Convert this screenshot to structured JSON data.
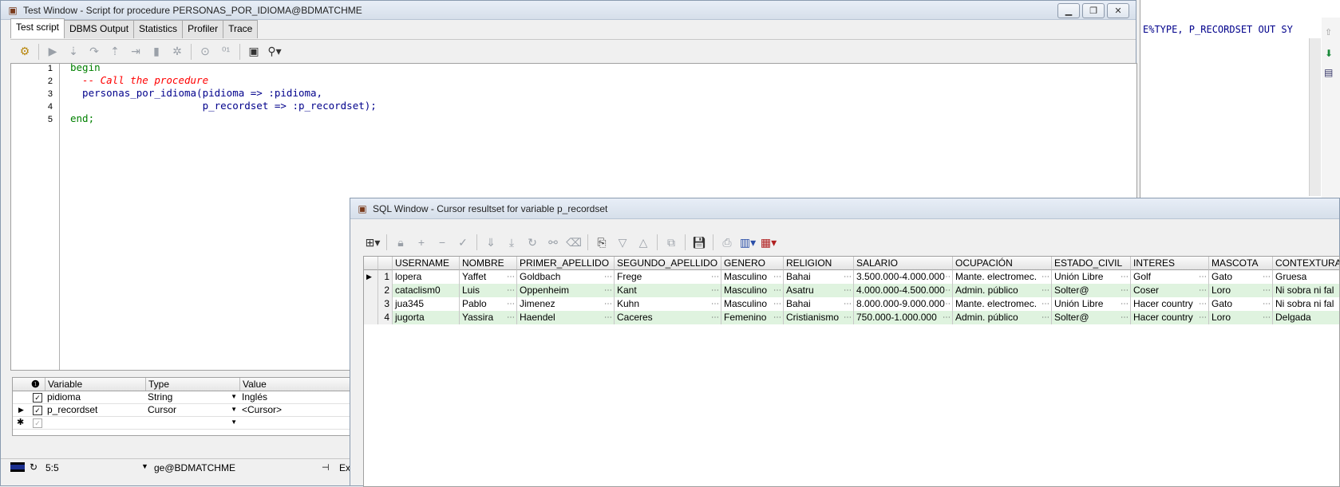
{
  "background_window": {
    "code_fragment": "E%TYPE, P_RECORDSET OUT SY"
  },
  "test_window": {
    "title": "Test Window - Script for procedure PERSONAS_POR_IDIOMA@BDMATCHME",
    "tabs": [
      "Test script",
      "DBMS Output",
      "Statistics",
      "Profiler",
      "Trace"
    ],
    "active_tab": "Test script",
    "code_lines": [
      {
        "n": "1",
        "text": "begin",
        "style": "kw"
      },
      {
        "n": "2",
        "text": "  -- Call the procedure",
        "style": "cm"
      },
      {
        "n": "3",
        "text": "  personas_por_idioma(pidioma => :pidioma,",
        "style": "id"
      },
      {
        "n": "4",
        "text": "                      p_recordset => :p_recordset);",
        "style": "id"
      },
      {
        "n": "5",
        "text": "end;",
        "style": "kw"
      }
    ],
    "variables": {
      "headers": [
        "Variable",
        "Type",
        "Value"
      ],
      "rows": [
        {
          "checked": true,
          "current": false,
          "name": "pidioma",
          "type": "String",
          "value": "Inglés"
        },
        {
          "checked": true,
          "current": true,
          "name": "p_recordset",
          "type": "Cursor",
          "value": "<Cursor>"
        }
      ]
    },
    "status": {
      "position": "5:5",
      "connection": "ge@BDMATCHME",
      "extra": "Ex"
    }
  },
  "sql_window": {
    "title": "SQL Window - Cursor resultset for variable p_recordset",
    "columns": [
      "USERNAME",
      "NOMBRE",
      "PRIMER_APELLIDO",
      "SEGUNDO_APELLIDO",
      "GENERO",
      "RELIGION",
      "SALARIO",
      "OCUPACIÓN",
      "ESTADO_CIVIL",
      "INTERES",
      "MASCOTA",
      "CONTEXTURA"
    ],
    "rows": [
      {
        "n": "1",
        "cells": [
          "lopera",
          "Yaffet",
          "Goldbach",
          "Frege",
          "Masculino",
          "Bahai",
          "3.500.000-4.000.000",
          "Mante. electromec.",
          "Unión Libre",
          "Golf",
          "Gato",
          "Gruesa"
        ]
      },
      {
        "n": "2",
        "cells": [
          "cataclism0",
          "Luis",
          "Oppenheim",
          "Kant",
          "Masculino",
          "Asatru",
          "4.000.000-4.500.000",
          "Admin. público",
          "Solter@",
          "Coser",
          "Loro",
          "Ni sobra ni fal"
        ]
      },
      {
        "n": "3",
        "cells": [
          "jua345",
          "Pablo",
          "Jimenez",
          "Kuhn",
          "Masculino",
          "Bahai",
          "8.000.000-9.000.000",
          "Mante. electromec.",
          "Unión Libre",
          "Hacer country",
          "Gato",
          "Ni sobra ni fal"
        ]
      },
      {
        "n": "4",
        "cells": [
          "jugorta",
          "Yassira",
          "Haendel",
          "Caceres",
          "Femenino",
          "Cristianismo",
          "750.000-1.000.000",
          "Admin. público",
          "Solter@",
          "Hacer country",
          "Loro",
          "Delgada"
        ]
      }
    ]
  },
  "colors": {
    "keyword": "#008000",
    "comment": "#ff0000",
    "identifier": "#00008b",
    "row_alt": "#dff3df"
  }
}
